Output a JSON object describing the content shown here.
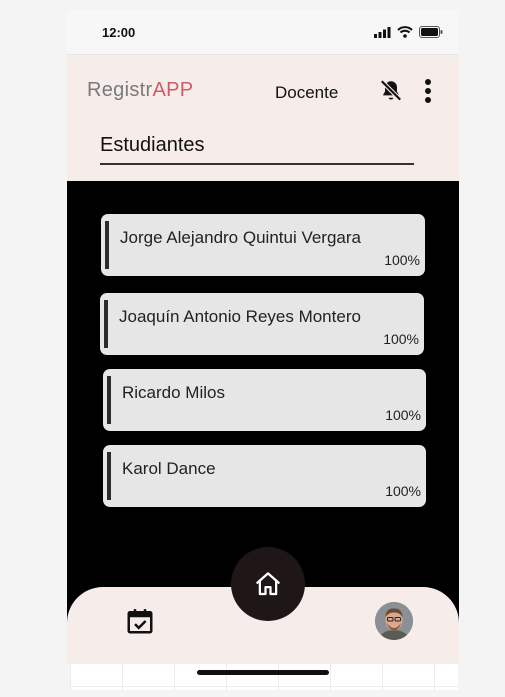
{
  "status_bar": {
    "time": "12:00"
  },
  "header": {
    "logo_prefix": "Registr",
    "logo_suffix": "APP",
    "role": "Docente",
    "section_title": "Estudiantes"
  },
  "students": [
    {
      "name": "Jorge Alejandro Quintui Vergara",
      "attendance": "100%"
    },
    {
      "name": "Joaquín Antonio Reyes Montero",
      "attendance": "100%"
    },
    {
      "name": "Ricardo Milos",
      "attendance": "100%"
    },
    {
      "name": "Karol Dance",
      "attendance": "100%"
    }
  ],
  "icons": {
    "notifications": "bell-off-icon",
    "menu": "more-vertical-icon",
    "home": "home-icon",
    "calendar": "calendar-check-icon",
    "profile": "avatar"
  },
  "colors": {
    "accent": "#cf5c63",
    "header_bg": "#f6ece9",
    "content_bg": "#000000",
    "card_bg": "#e6e6e6",
    "home_button": "#1f1717"
  }
}
